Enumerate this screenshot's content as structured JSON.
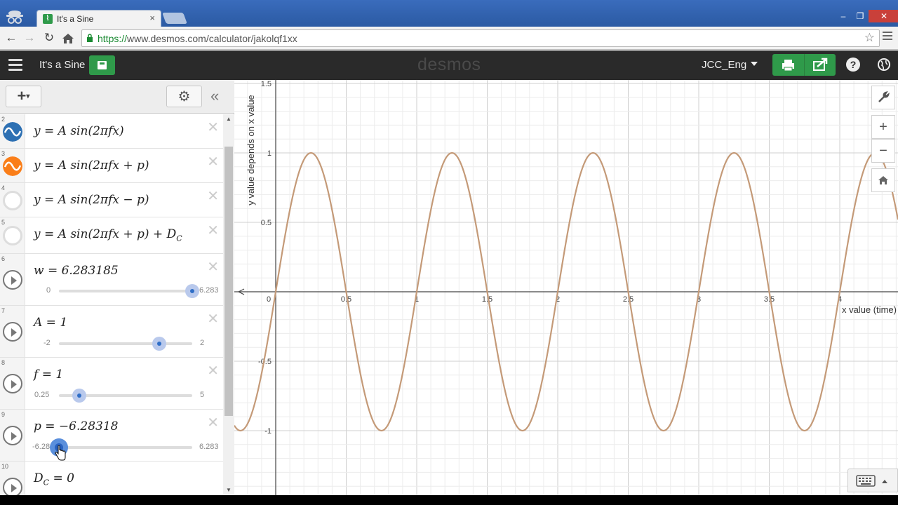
{
  "browser": {
    "tab_title": "It's a Sine",
    "tab_close": "×",
    "url_scheme": "https://",
    "url_rest": "www.desmos.com/calculator/jakolqf1xx"
  },
  "header": {
    "graph_title": "It's a Sine",
    "logo": "desmos",
    "user": "JCC_Eng",
    "help": "?"
  },
  "expressions": [
    {
      "num": "2",
      "latex": "y = A sin(2πfx)",
      "icon": "blue-sine-icon"
    },
    {
      "num": "3",
      "latex": "y = A sin(2πfx + p)",
      "icon": "orange-sine-icon"
    },
    {
      "num": "4",
      "latex": "y = A sin(2πfx − p)",
      "icon": "hidden-icon"
    },
    {
      "num": "5",
      "latex": "y = A sin(2πfx + p) + D",
      "sub": "C",
      "icon": "hidden-icon"
    },
    {
      "num": "6",
      "latex": "w = 6.283185",
      "min": "0",
      "max": "6.283",
      "value_frac": 1.0
    },
    {
      "num": "7",
      "latex": "A = 1",
      "min": "-2",
      "max": "2",
      "value_frac": 0.75
    },
    {
      "num": "8",
      "latex": "f = 1",
      "min": "0.25",
      "max": "5",
      "value_frac": 0.158
    },
    {
      "num": "9",
      "latex": "p = −6.28318",
      "min": "-6.28",
      "max": "6.283",
      "value_frac": 0.0
    },
    {
      "num": "10",
      "latex": "D",
      "sub": "C",
      "latex_tail": " = 0"
    }
  ],
  "graph": {
    "x_label": "x value (time)",
    "y_label": "y value depends on x value",
    "x_ticks": [
      "0",
      "0.5",
      "1",
      "1.5",
      "2",
      "2.5",
      "3",
      "3.5",
      "4"
    ],
    "y_ticks": [
      "1.5",
      "1",
      "0.5",
      "-0.5",
      "-1"
    ],
    "curve_color": "#c49a78",
    "amplitude": 1,
    "frequency": 1
  },
  "tools": {
    "wrench": "wrench-icon",
    "zoom_in": "+",
    "zoom_out": "−",
    "home": "home-icon"
  }
}
